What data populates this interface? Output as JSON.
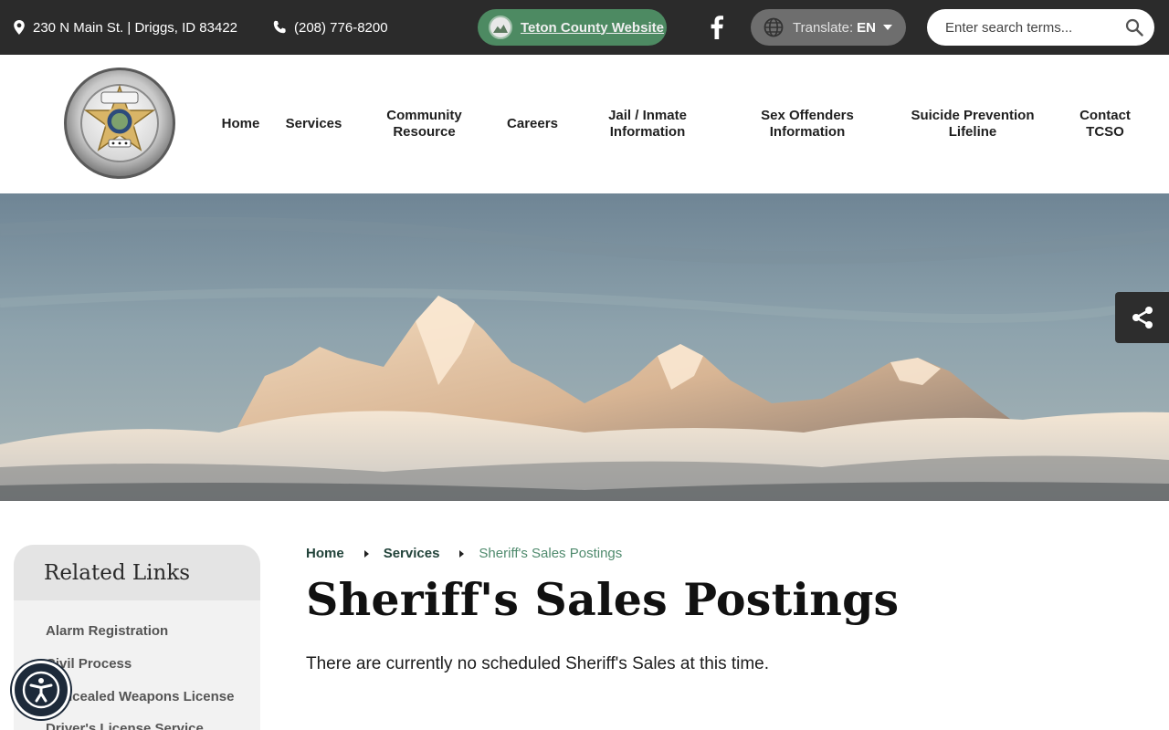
{
  "topbar": {
    "address": "230 N Main St. | Driggs, ID 83422",
    "phone": "(208) 776-8200",
    "county_link": "Teton County Website",
    "translate_label": "Translate:",
    "translate_lang": "EN",
    "search_placeholder": "Enter search terms..."
  },
  "header": {
    "logo_text": [
      "TETON COUNTY SHERIFF",
      "SHERIFF",
      "ESTABLISHED 1915"
    ],
    "nav": [
      {
        "label": "Home"
      },
      {
        "label": "Services"
      },
      {
        "label": "Community Resource"
      },
      {
        "label": "Careers"
      },
      {
        "label": "Jail / Inmate Information"
      },
      {
        "label": "Sex Offenders Information"
      },
      {
        "label": "Suicide Prevention Lifeline"
      },
      {
        "label": "Contact TCSO"
      }
    ]
  },
  "sidebar": {
    "title": "Related Links",
    "links": [
      {
        "label": "Alarm Registration"
      },
      {
        "label": "Civil Process"
      },
      {
        "label": "Concealed Weapons License"
      },
      {
        "label": "Driver's License Service"
      }
    ]
  },
  "breadcrumb": {
    "home": "Home",
    "services": "Services",
    "current": "Sheriff's Sales Postings"
  },
  "main": {
    "title": "Sheriff's Sales Postings",
    "body": "There are currently no scheduled Sheriff's Sales at this time."
  },
  "icons": {
    "location": "map-pin-icon",
    "phone": "phone-icon",
    "facebook": "facebook-icon",
    "globe": "globe-icon",
    "search": "search-icon",
    "share": "share-icon",
    "accessibility": "accessibility-icon"
  },
  "colors": {
    "topbar": "#2b2b2b",
    "county_button": "#4d8a62",
    "translate_button": "#6e6e6e",
    "breadcrumb_current": "#4f8a6d",
    "sidebar_bg": "#f2f2f2"
  }
}
